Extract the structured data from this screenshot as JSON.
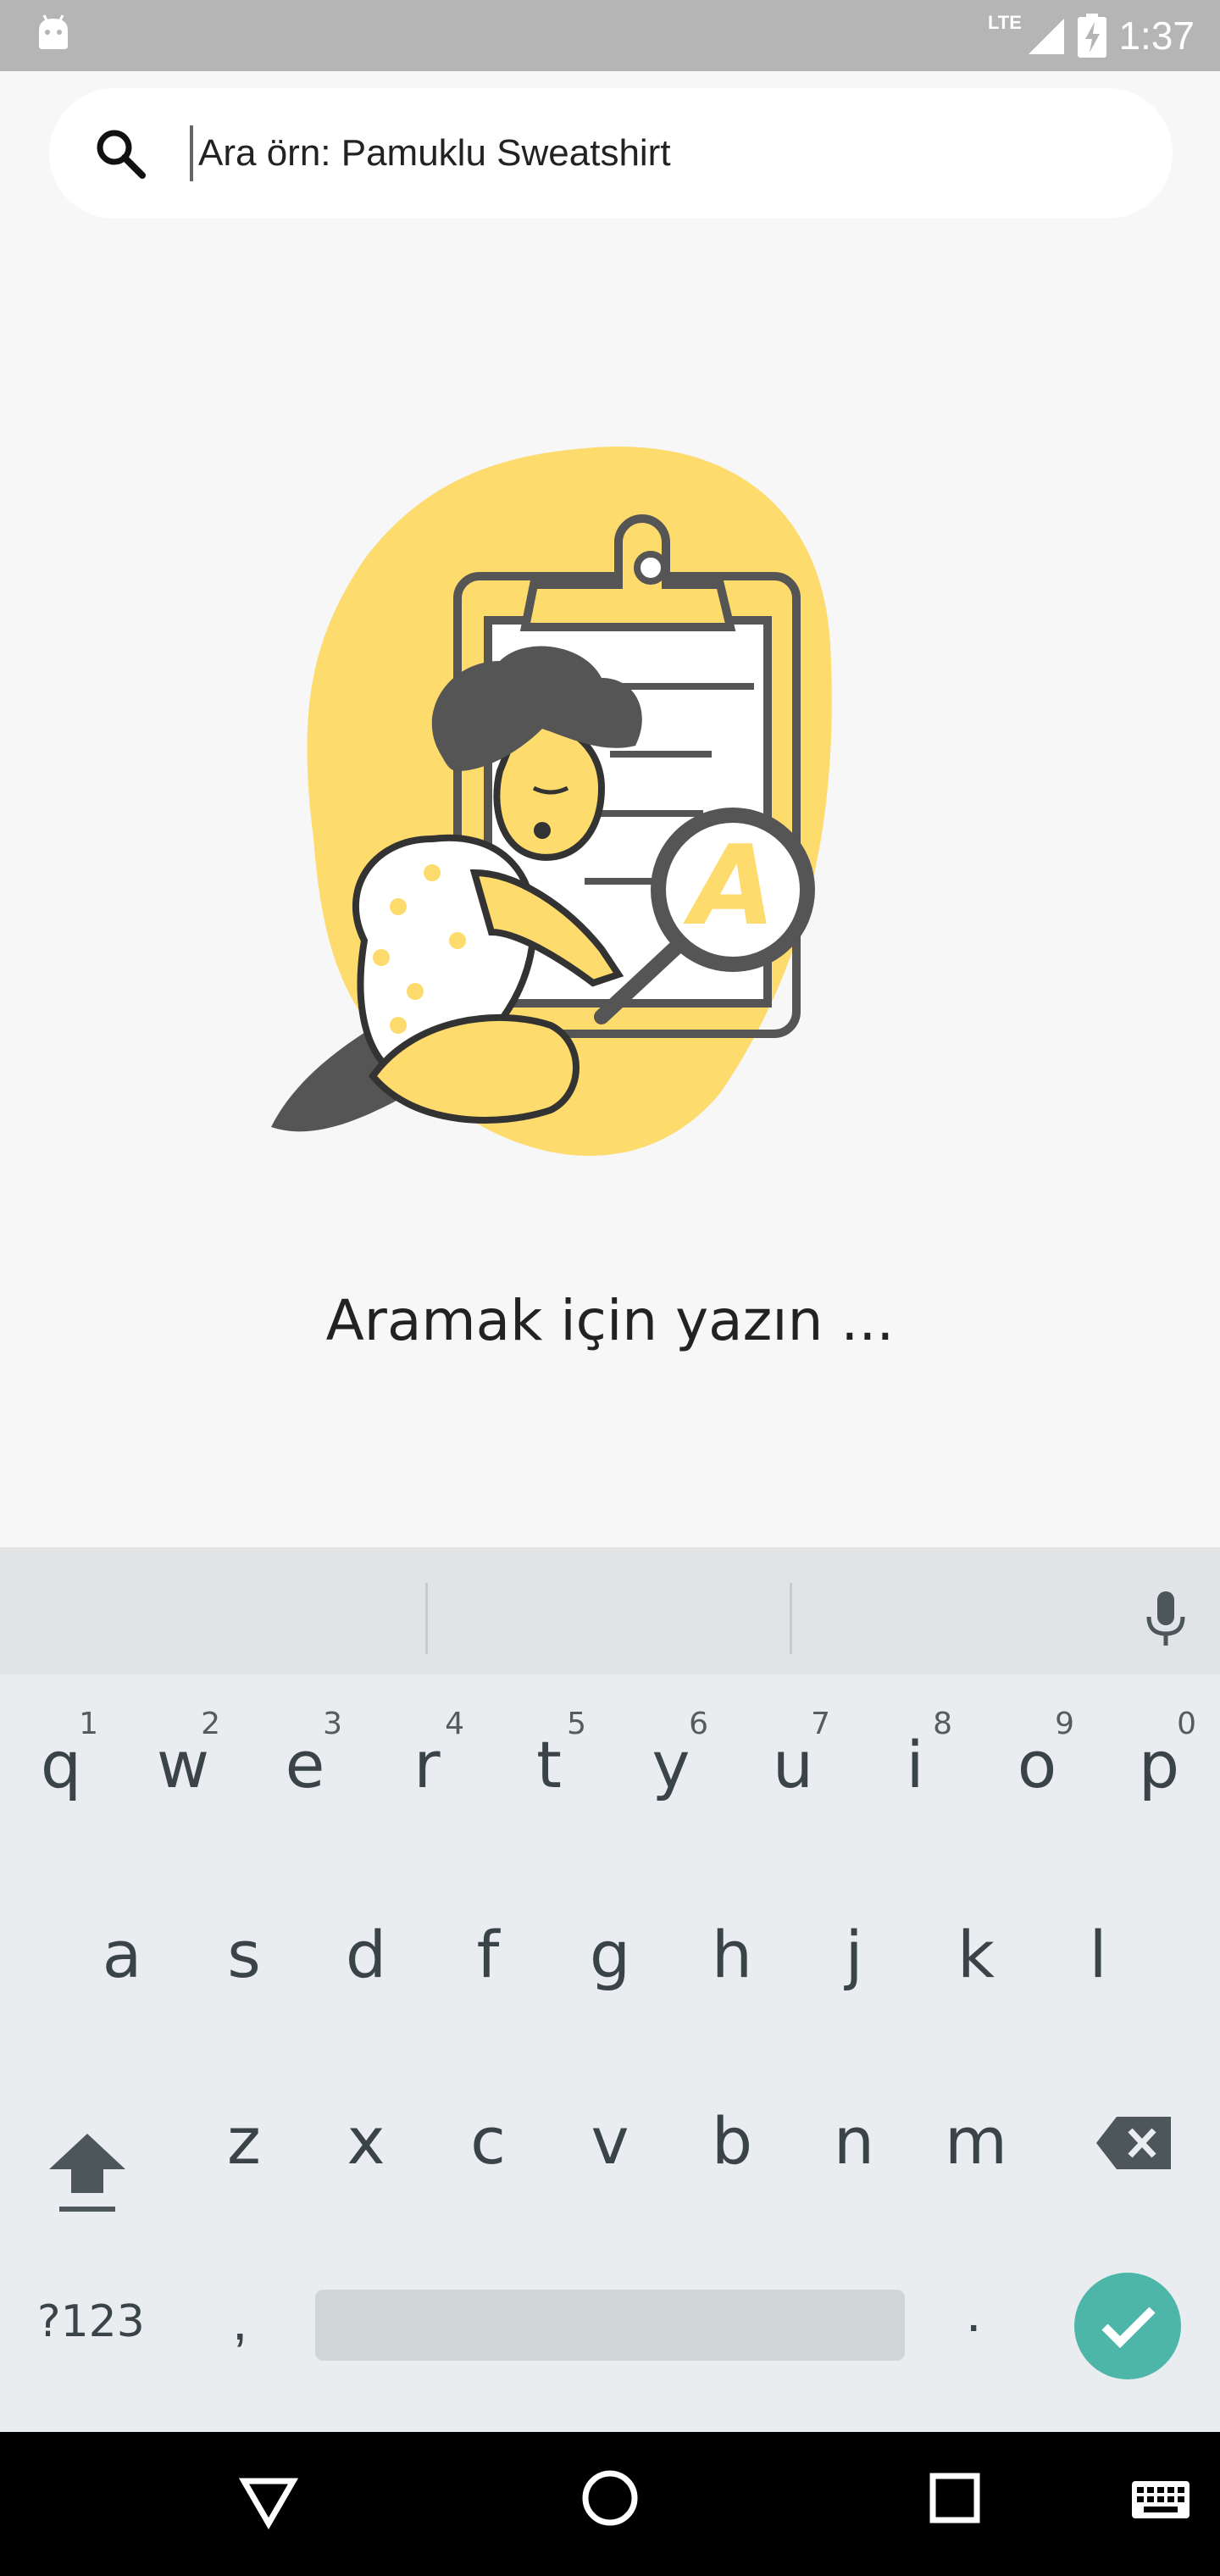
{
  "status": {
    "network": "LTE",
    "time": "1:37"
  },
  "search": {
    "placeholder": "Ara örn: Pamuklu Sweatshirt",
    "value": ""
  },
  "illustration": {
    "badge_letter": "A"
  },
  "empty_state": {
    "text": "Aramak için yazın ..."
  },
  "keyboard": {
    "row1": [
      {
        "k": "q",
        "n": "1"
      },
      {
        "k": "w",
        "n": "2"
      },
      {
        "k": "e",
        "n": "3"
      },
      {
        "k": "r",
        "n": "4"
      },
      {
        "k": "t",
        "n": "5"
      },
      {
        "k": "y",
        "n": "6"
      },
      {
        "k": "u",
        "n": "7"
      },
      {
        "k": "i",
        "n": "8"
      },
      {
        "k": "o",
        "n": "9"
      },
      {
        "k": "p",
        "n": "0"
      }
    ],
    "row2": [
      "a",
      "s",
      "d",
      "f",
      "g",
      "h",
      "j",
      "k",
      "l"
    ],
    "row3": [
      "z",
      "x",
      "c",
      "v",
      "b",
      "n",
      "m"
    ],
    "symbols_label": "?123",
    "comma_label": ",",
    "period_label": ".",
    "icons": {
      "shift": "shift-icon",
      "backspace": "backspace-icon",
      "enter": "checkmark-icon",
      "mic": "microphone-icon"
    }
  },
  "colors": {
    "accent_yellow": "#fddb6d",
    "enter_teal": "#4db6a9",
    "status_bar": "#b5b5b5"
  }
}
